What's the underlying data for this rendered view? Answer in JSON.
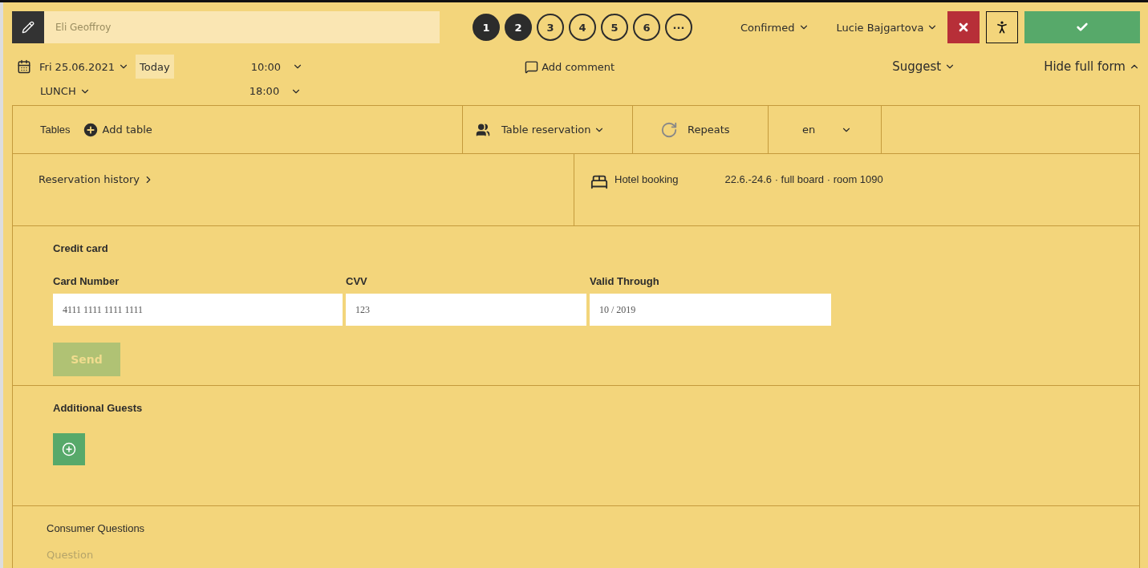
{
  "header": {
    "name_field": {
      "placeholder": "Eli Geoffroy"
    },
    "steps": [
      {
        "label": "1",
        "active": true
      },
      {
        "label": "2",
        "active": true
      },
      {
        "label": "3",
        "active": false
      },
      {
        "label": "4",
        "active": false
      },
      {
        "label": "5",
        "active": false
      },
      {
        "label": "6",
        "active": false
      },
      {
        "label": "···",
        "active": false
      }
    ],
    "status": "Confirmed",
    "user": "Lucie Bajgartova"
  },
  "schedule": {
    "date": "Fri 25.06.2021",
    "today": "Today",
    "start_time": "10:00",
    "meal": "LUNCH",
    "end_time": "18:00",
    "add_comment": "Add comment",
    "suggest": "Suggest",
    "hide_form": "Hide full form"
  },
  "tables": {
    "label": "Tables",
    "add_table": "Add table",
    "reservation_type": "Table reservation",
    "repeats": "Repeats",
    "language": "en"
  },
  "history": {
    "label": "Reservation history",
    "hotel_label": "Hotel booking",
    "hotel_details": "22.6.-24.6 · full board · room 1090"
  },
  "credit_card": {
    "title": "Credit card",
    "fields": [
      {
        "label": "Card Number",
        "value": "4111 1111 1111 1111"
      },
      {
        "label": "CVV",
        "value": "123"
      },
      {
        "label": "Valid Through",
        "value": "10 / 2019"
      }
    ],
    "send": "Send",
    "send_disabled": true
  },
  "additional_guests": {
    "title": "Additional Guests"
  },
  "consumer_questions": {
    "title": "Consumer Questions",
    "placeholder": "Question"
  }
}
